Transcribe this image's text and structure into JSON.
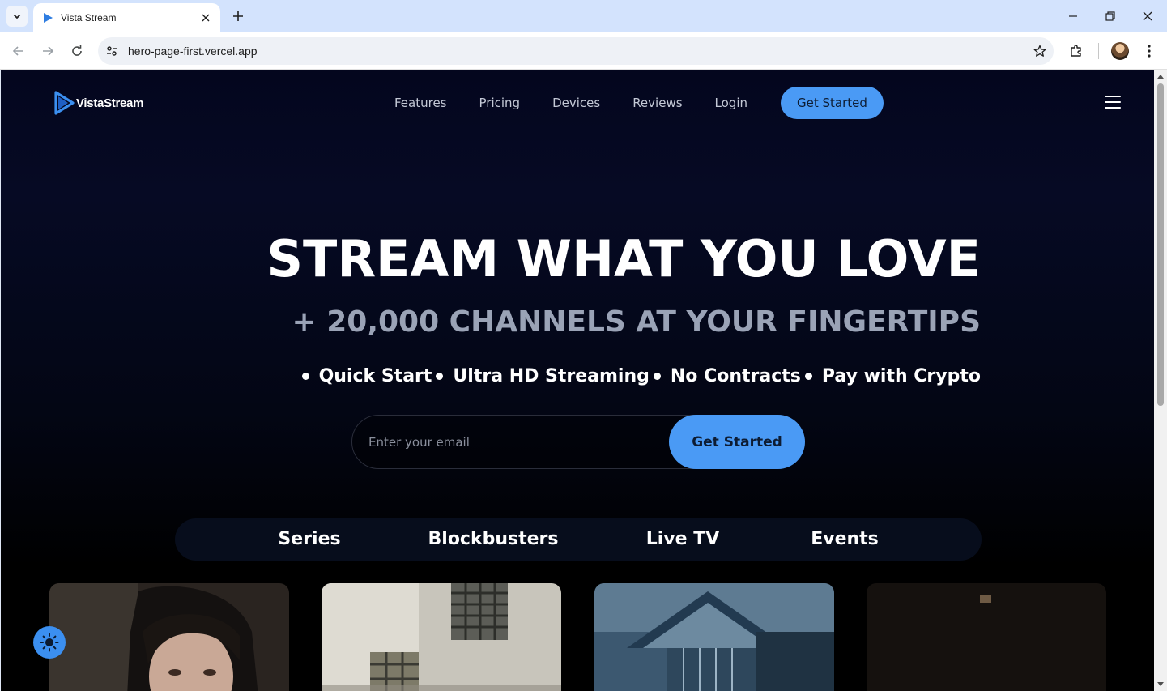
{
  "browser": {
    "tab_title": "Vista Stream",
    "url": "hero-page-first.vercel.app"
  },
  "site": {
    "logo_text": "VistaStream",
    "brand_color": "#4a9af5",
    "nav": {
      "items": [
        {
          "label": "Features"
        },
        {
          "label": "Pricing"
        },
        {
          "label": "Devices"
        },
        {
          "label": "Reviews"
        },
        {
          "label": "Login"
        }
      ],
      "cta_label": "Get Started"
    },
    "hero": {
      "title": "STREAM WHAT YOU LOVE",
      "subtitle": "+ 20,000 CHANNELS AT YOUR FINGERTIPS",
      "features": [
        "Quick Start",
        "Ultra HD Streaming",
        "No Contracts",
        "Pay with Crypto"
      ],
      "email_placeholder": "Enter your email",
      "cta_label": "Get Started"
    },
    "categories": [
      "Series",
      "Blockbusters",
      "Live TV",
      "Events"
    ],
    "cards": [
      {
        "image": "portrait-woman"
      },
      {
        "image": "old-building-windows"
      },
      {
        "image": "house-roof"
      },
      {
        "image": "dark-stage"
      }
    ],
    "theme_toggle_icon": "sun-icon"
  }
}
